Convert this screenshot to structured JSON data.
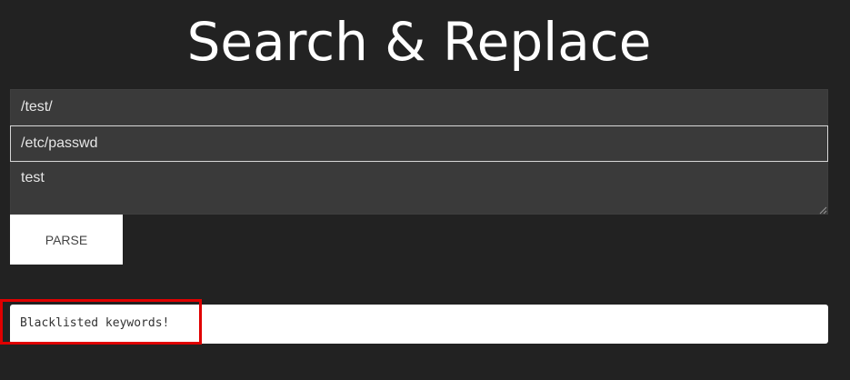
{
  "header": {
    "title": "Search & Replace"
  },
  "form": {
    "search_value": "/test/",
    "replace_value": "/etc/passwd",
    "text_value": "test",
    "parse_label": "PARSE"
  },
  "output": {
    "message": "Blacklisted keywords!"
  },
  "colors": {
    "background": "#222222",
    "field_background": "#3a3a3a",
    "highlight_border": "#e00000"
  }
}
